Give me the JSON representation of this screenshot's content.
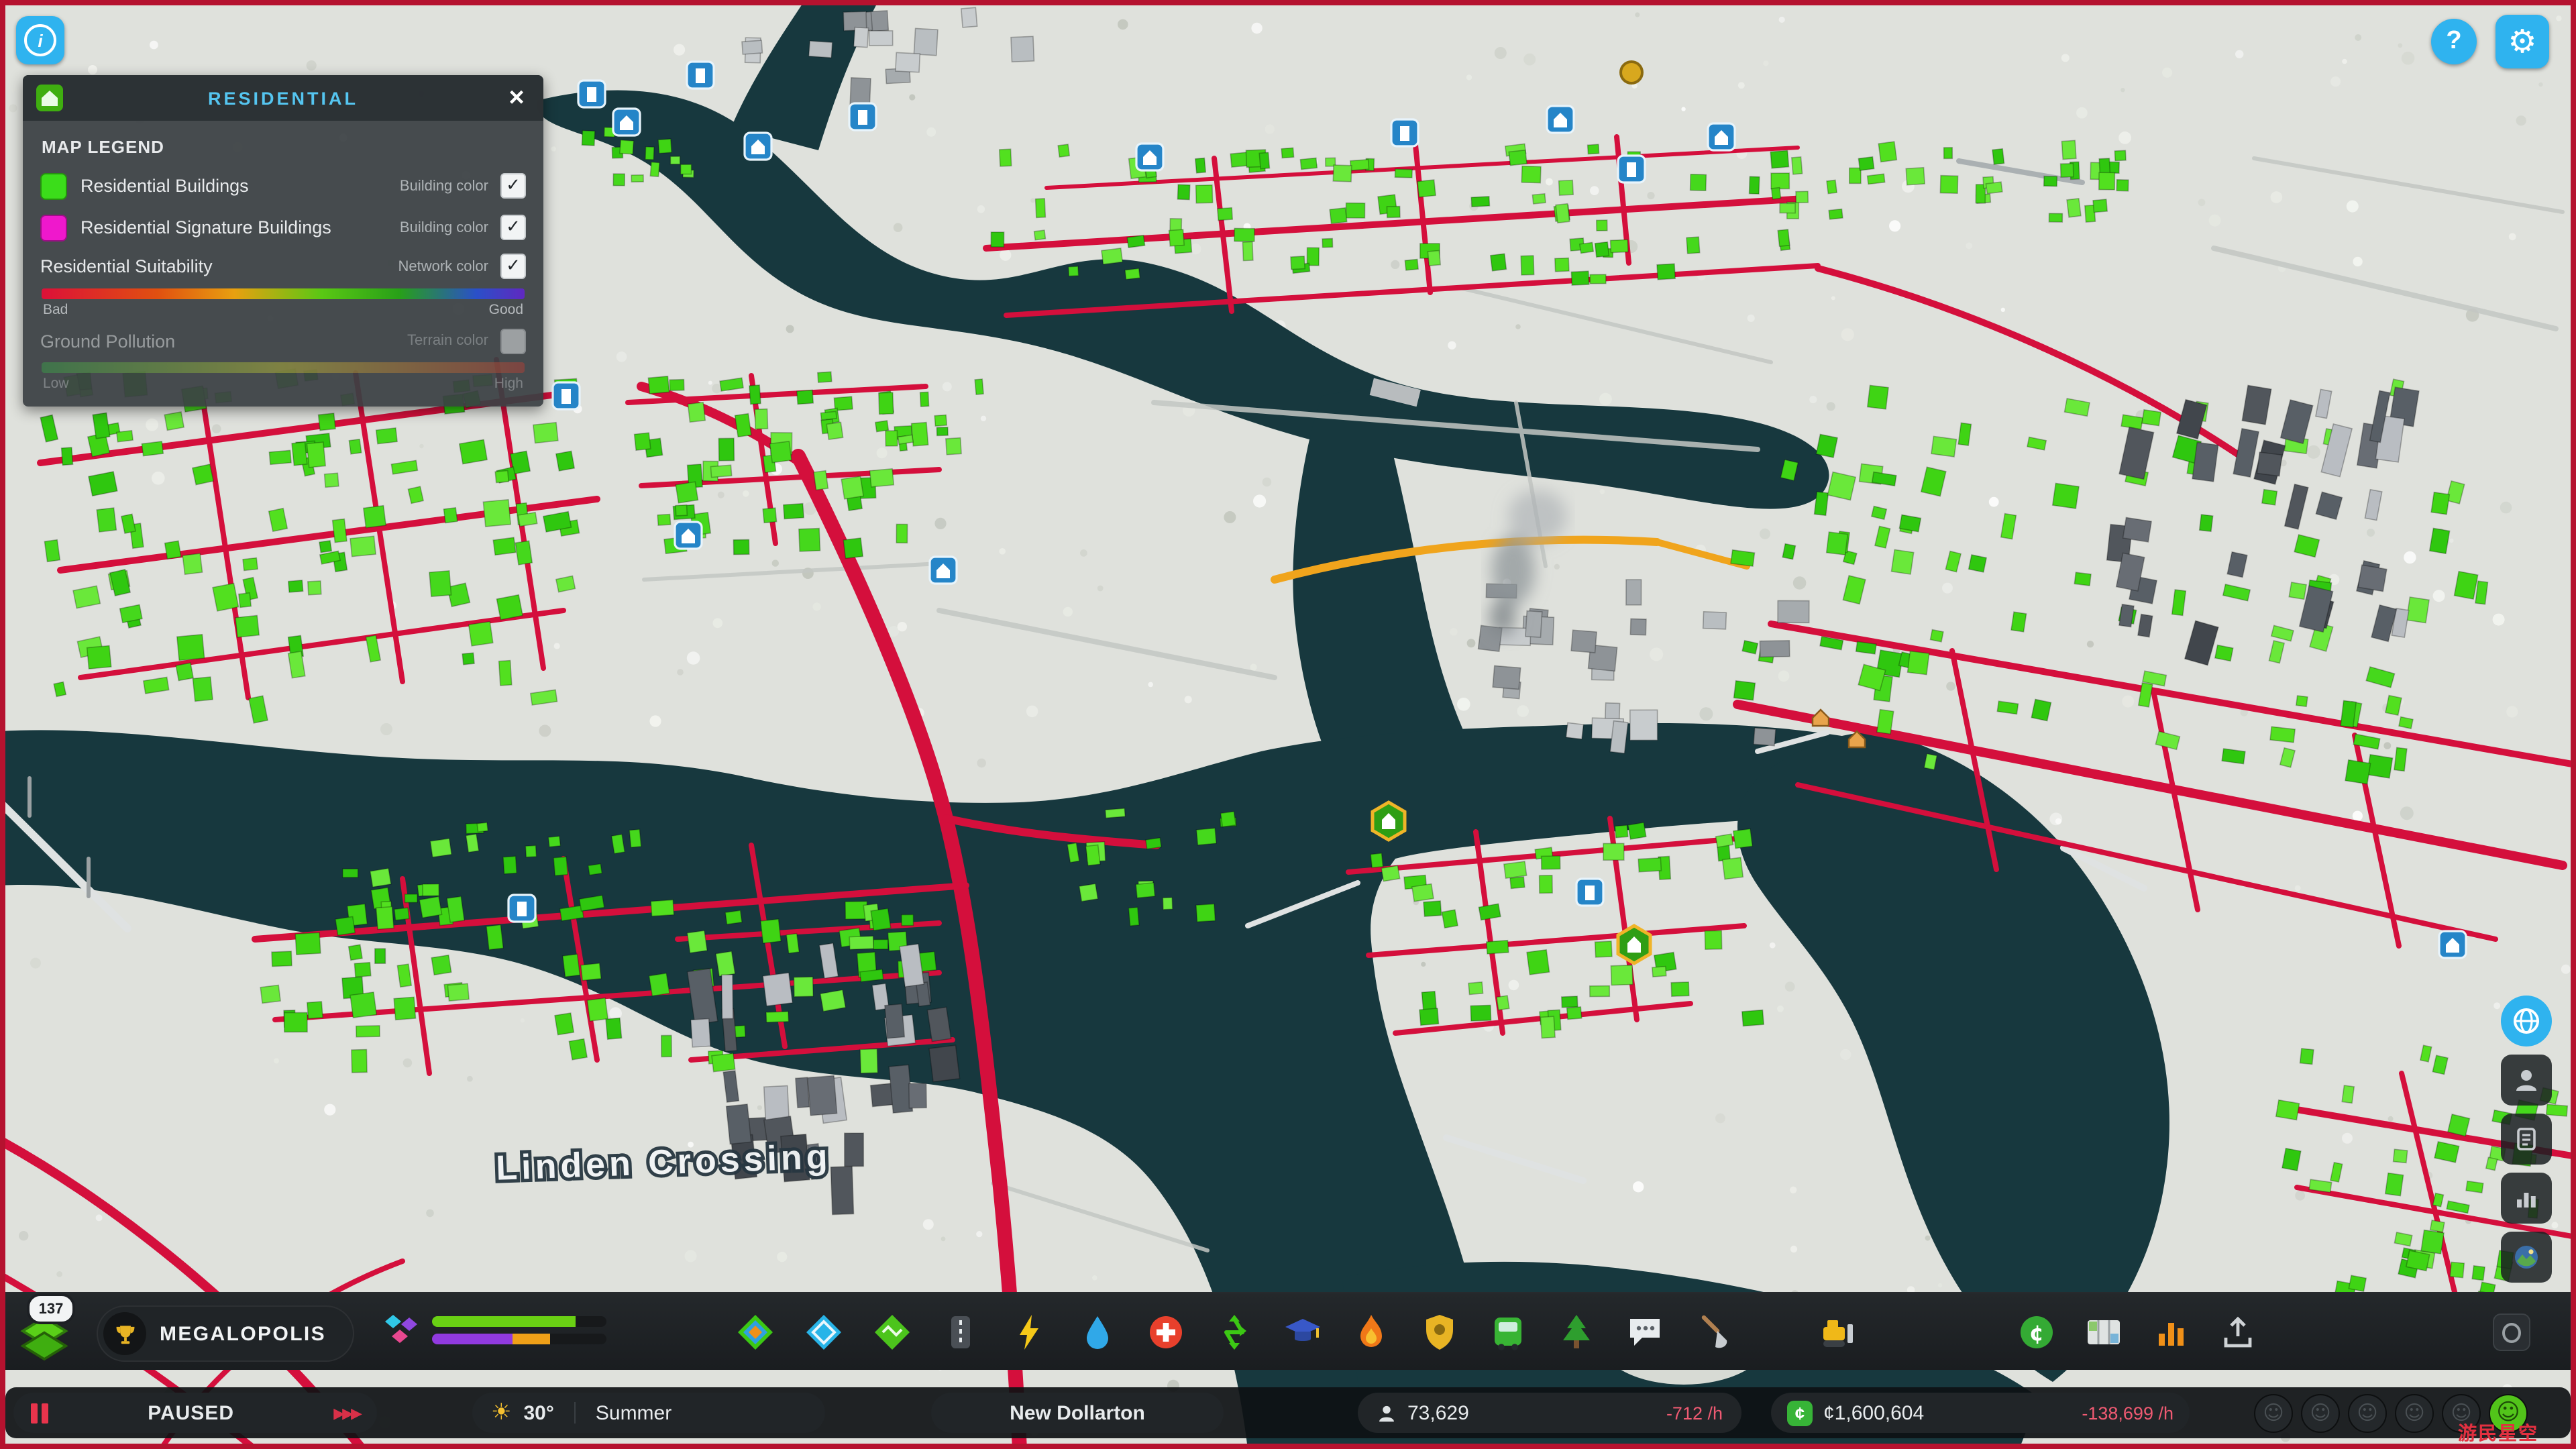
{
  "window": {
    "watermark": "游民星空"
  },
  "icons": {
    "info": "i",
    "help": "?",
    "gear": "⚙",
    "close": "×",
    "check": "✓",
    "sun": "☀",
    "fast_forward": "▶▶▶",
    "cent": "¢",
    "smiley": "☺",
    "hide_ui": "◎"
  },
  "colors": {
    "accent_blue": "#2fb3ef",
    "residential_swatch": "#3bdd1a",
    "signature_swatch": "#ef18cc",
    "negative_red": "#ef5a72",
    "money_green": "#37b437",
    "road_red": "#d40f3c",
    "water": "#17383e"
  },
  "legend_panel": {
    "title": "RESIDENTIAL",
    "section": "MAP LEGEND",
    "rows": {
      "residential_buildings": {
        "label": "Residential Buildings",
        "color_type": "Building color",
        "checked": true
      },
      "signature_buildings": {
        "label": "Residential Signature Buildings",
        "color_type": "Building color",
        "checked": true
      },
      "suitability": {
        "label": "Residential Suitability",
        "color_type": "Network color",
        "checked": true,
        "scale_min": "Bad",
        "scale_max": "Good"
      },
      "ground_pollution": {
        "label": "Ground Pollution",
        "color_type": "Terrain color",
        "checked": false,
        "scale_min": "Low",
        "scale_max": "High"
      }
    }
  },
  "map": {
    "place_label": "Linden Crossing"
  },
  "toolbar": {
    "level": "137",
    "milestone": "MEGALOPOLIS",
    "tools": [
      "zones",
      "signature-buildings",
      "areas",
      "roads",
      "electricity",
      "water-sewage",
      "health-deathcare",
      "garbage-management",
      "education-research",
      "fire-rescue",
      "police-administration",
      "transportation",
      "parks-recreation",
      "communications",
      "landscaping",
      "bulldozer",
      "economy",
      "map-tiles",
      "statistics",
      "share"
    ]
  },
  "status_bar": {
    "sim_state": "PAUSED",
    "temperature": "30°",
    "season": "Summer",
    "city_name": "New Dollarton",
    "population": "73,629",
    "population_trend": "-712 /h",
    "balance": "¢1,600,604",
    "balance_trend": "-138,699 /h"
  }
}
